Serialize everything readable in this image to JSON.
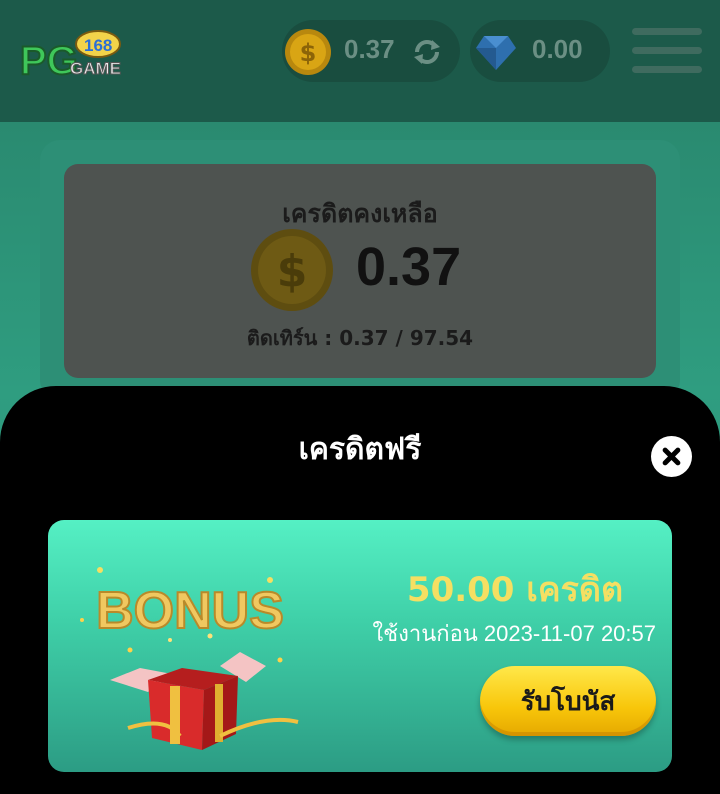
{
  "header": {
    "logo_text": "PG 168 GAME",
    "coin_balance": "0.37",
    "gem_balance": "0.00"
  },
  "balance": {
    "title": "เครดิตคงเหลือ",
    "value": "0.37",
    "turnover": "ติดเทิร์น : 0.37 / 97.54"
  },
  "modal": {
    "title": "เครดิตฟรี",
    "bonus": {
      "amount": "50.00 เครดิต",
      "expiry": "ใช้งานก่อน 2023-11-07 20:57",
      "claim_label": "รับโบนัส",
      "art_text": "BONUS"
    }
  },
  "colors": {
    "accent_yellow": "#f5df62",
    "card_green": "#55f0c4",
    "button_yellow": "#f8c60a"
  }
}
